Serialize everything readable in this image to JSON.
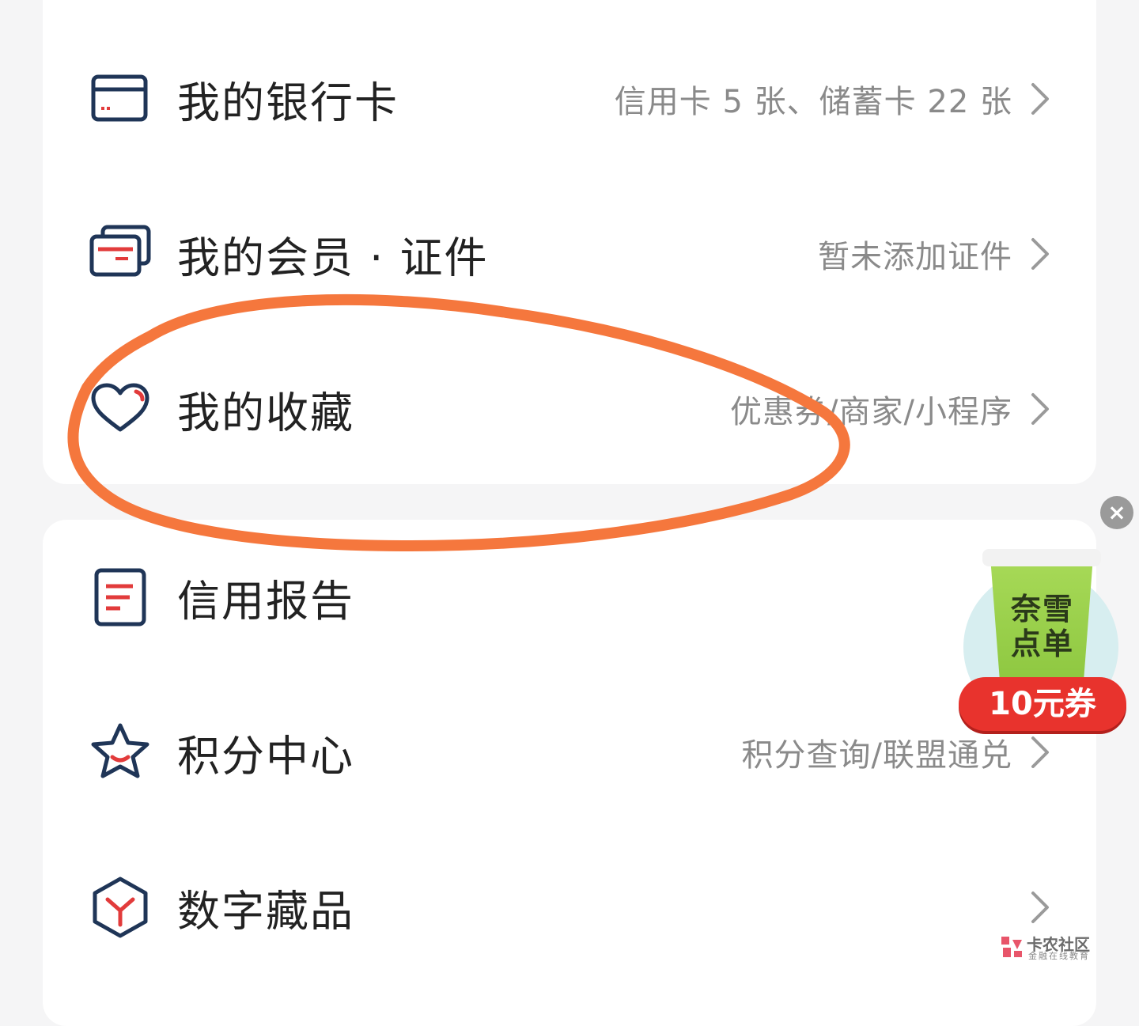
{
  "colors": {
    "background": "#f5f5f6",
    "card": "#ffffff",
    "title_text": "#222222",
    "subtitle_text": "#8a8a8a",
    "icon_navy": "#1f3557",
    "icon_red": "#e23b3b",
    "annotation_orange": "#f5773d"
  },
  "menu": [
    {
      "id": "bank-card",
      "icon": "bank-card-icon",
      "title": "我的银行卡",
      "subtitle": "信用卡 5 张、储蓄卡 22 张"
    },
    {
      "id": "membership",
      "icon": "membership-cards-icon",
      "title": "我的会员 · 证件",
      "subtitle": "暂未添加证件"
    },
    {
      "id": "favorites",
      "icon": "heart-icon",
      "title": "我的收藏",
      "subtitle": "优惠券/商家/小程序"
    },
    {
      "id": "credit-report",
      "icon": "document-icon",
      "title": "信用报告",
      "subtitle": ""
    },
    {
      "id": "points",
      "icon": "star-icon",
      "title": "积分中心",
      "subtitle": "积分查询/联盟通兑"
    },
    {
      "id": "digital-collectibles",
      "icon": "cube-icon",
      "title": "数字藏品",
      "subtitle": ""
    }
  ],
  "ad": {
    "close_icon": "close-icon",
    "brand": "奈雪点单",
    "coupon": "10元券"
  },
  "watermark": {
    "name": "卡农社区",
    "sub": "金融在线教育"
  }
}
